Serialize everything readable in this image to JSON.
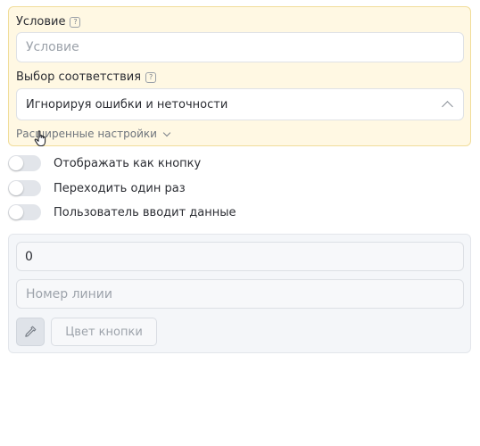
{
  "condition": {
    "label": "Условие",
    "help": "?",
    "placeholder": "Условие",
    "value": ""
  },
  "match": {
    "label": "Выбор соответствия",
    "help": "?",
    "selected": "Игнорируя ошибки и неточности"
  },
  "advanced": {
    "label": "Расширенные настройки"
  },
  "toggles": [
    {
      "label": "Отображать как кнопку",
      "on": false
    },
    {
      "label": "Переходить один раз",
      "on": false
    },
    {
      "label": "Пользователь вводит данные",
      "on": false
    }
  ],
  "button_settings": {
    "number_value": "0",
    "line_placeholder": "Номер линии",
    "color_button_label": "Цвет кнопки"
  },
  "colors": {
    "highlight_bg": "#fff8e3",
    "highlight_border": "#f1dd9a",
    "toggle_off": "#e2e5ea"
  }
}
